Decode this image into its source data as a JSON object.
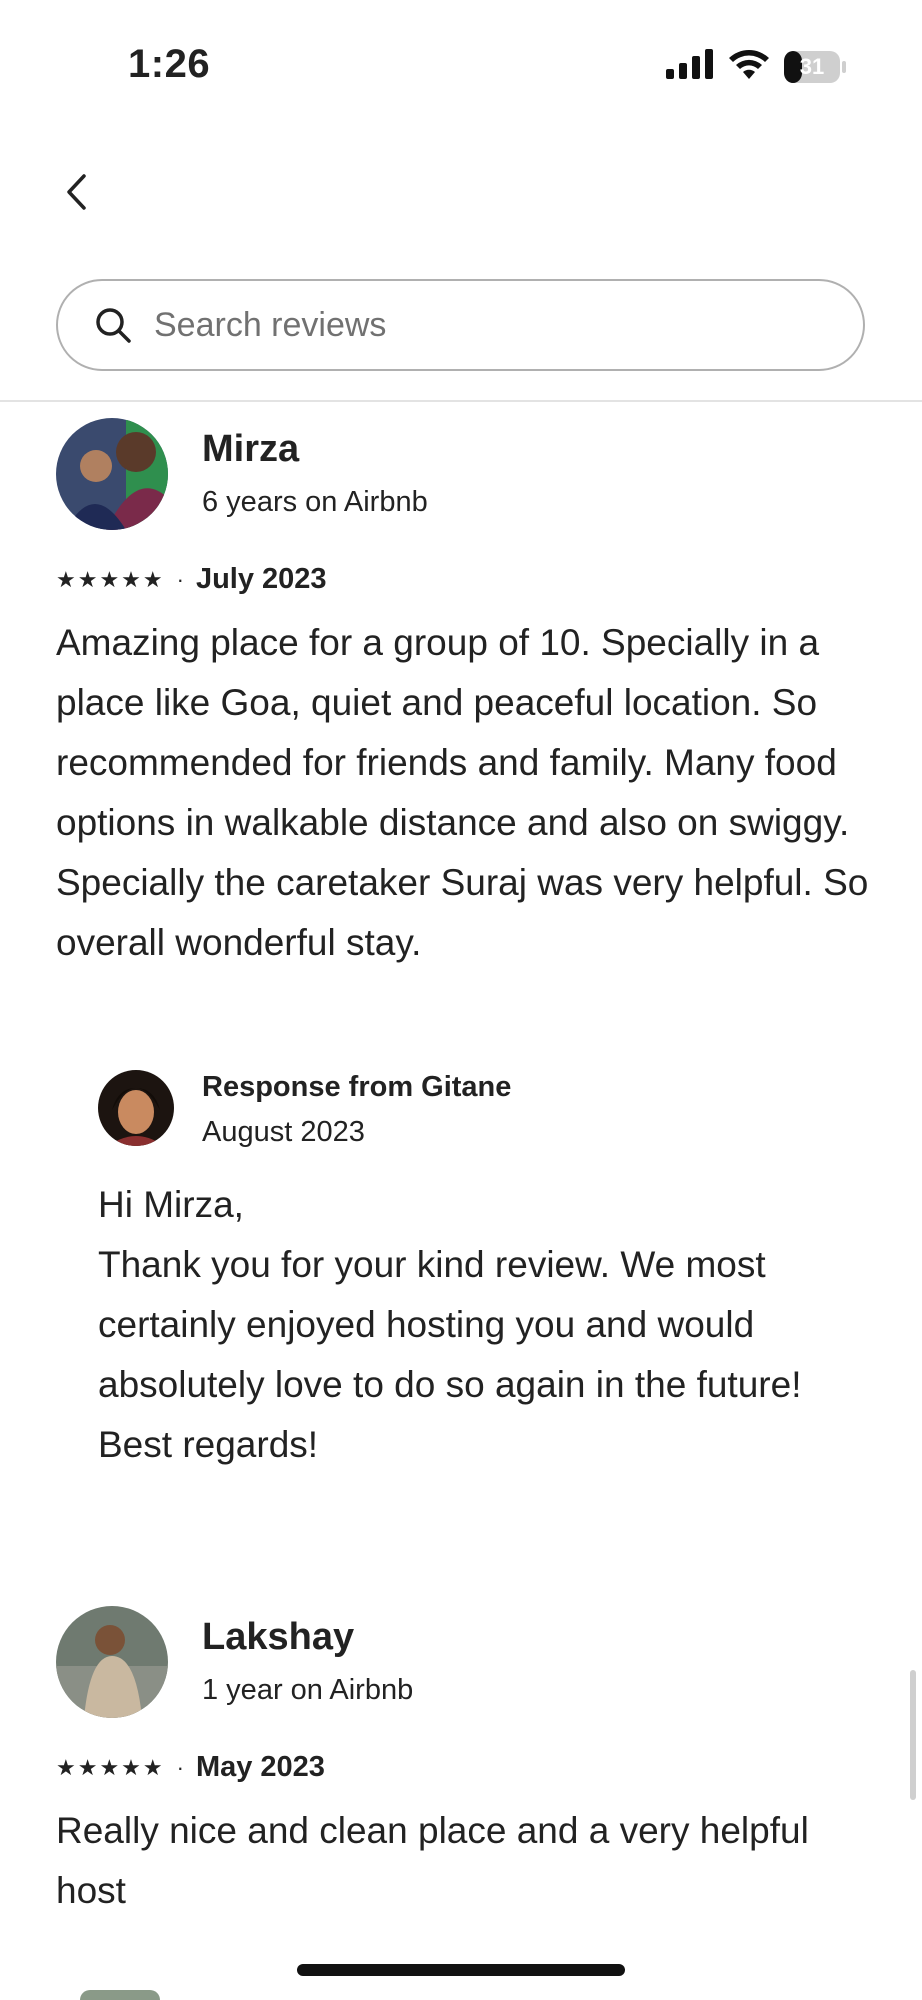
{
  "status_bar": {
    "time": "1:26",
    "battery_level": "31",
    "icons": [
      "signal-icon",
      "wifi-icon",
      "battery-icon"
    ]
  },
  "header": {
    "back_icon": "chevron-left-icon",
    "search": {
      "placeholder": "Search reviews",
      "value": "",
      "icon": "search-icon"
    }
  },
  "reviews": [
    {
      "name": "Mirza",
      "tenure": "6 years on Airbnb",
      "rating": 5,
      "stars": "★★★★★",
      "separator": "·",
      "date": "July 2023",
      "text": "Amazing place for a group of 10. Specially in a place like Goa, quiet and peaceful location. So recommended for friends and family. Many food options in walkable distance and also on swiggy. Specially the caretaker Suraj was very helpful. So overall wonderful stay.",
      "response": {
        "title": "Response from Gitane",
        "date": "August 2023",
        "text": "Hi Mirza,\nThank you for your kind review. We most certainly enjoyed hosting you and would absolutely love to do so again in the future!\nBest regards!"
      }
    },
    {
      "name": "Lakshay",
      "tenure": "1 year on Airbnb",
      "rating": 5,
      "stars": "★★★★★",
      "separator": "·",
      "date": "May 2023",
      "text": "Really nice and clean place and a very helpful host"
    }
  ],
  "colors": {
    "text": "#222222",
    "secondary_text": "#717171",
    "border": "#b0b0b0",
    "divider": "#e3e3e3"
  }
}
